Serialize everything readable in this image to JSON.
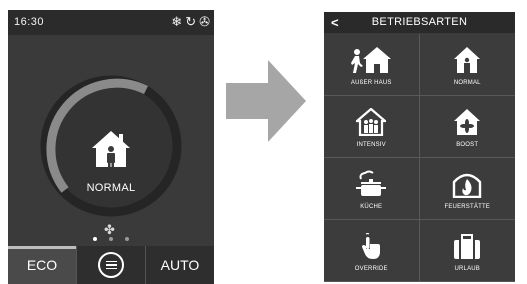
{
  "left_screen": {
    "time": "16:30",
    "status_icons": [
      "snowflake-icon",
      "refresh-icon",
      "fan-icon"
    ],
    "mode_label": "NORMAL",
    "page_dots": 3,
    "active_dot": 0,
    "bottom": {
      "eco_label": "ECO",
      "auto_label": "AUTO"
    }
  },
  "right_screen": {
    "title": "BETRIEBSARTEN",
    "back_glyph": "<",
    "modes": [
      {
        "label": "AUßER HAUS",
        "icon": "away-house-icon"
      },
      {
        "label": "NORMAL",
        "icon": "house-person-icon"
      },
      {
        "label": "INTENSIV",
        "icon": "house-people-icon"
      },
      {
        "label": "BOOST",
        "icon": "house-fan-icon"
      },
      {
        "label": "KÜCHE",
        "icon": "cooking-pot-icon"
      },
      {
        "label": "FEUERSTÄTTE",
        "icon": "fireplace-icon"
      },
      {
        "label": "OVERRIDE",
        "icon": "hand-pointer-icon"
      },
      {
        "label": "URLAUB",
        "icon": "suitcase-icon"
      }
    ]
  },
  "colors": {
    "screen_bg": "#3a3a3a",
    "bar_bg": "#2b2b2b",
    "ring_track": "#252525",
    "ring_fill": "#8a8a8a",
    "arrow": "#a6a6a6"
  }
}
